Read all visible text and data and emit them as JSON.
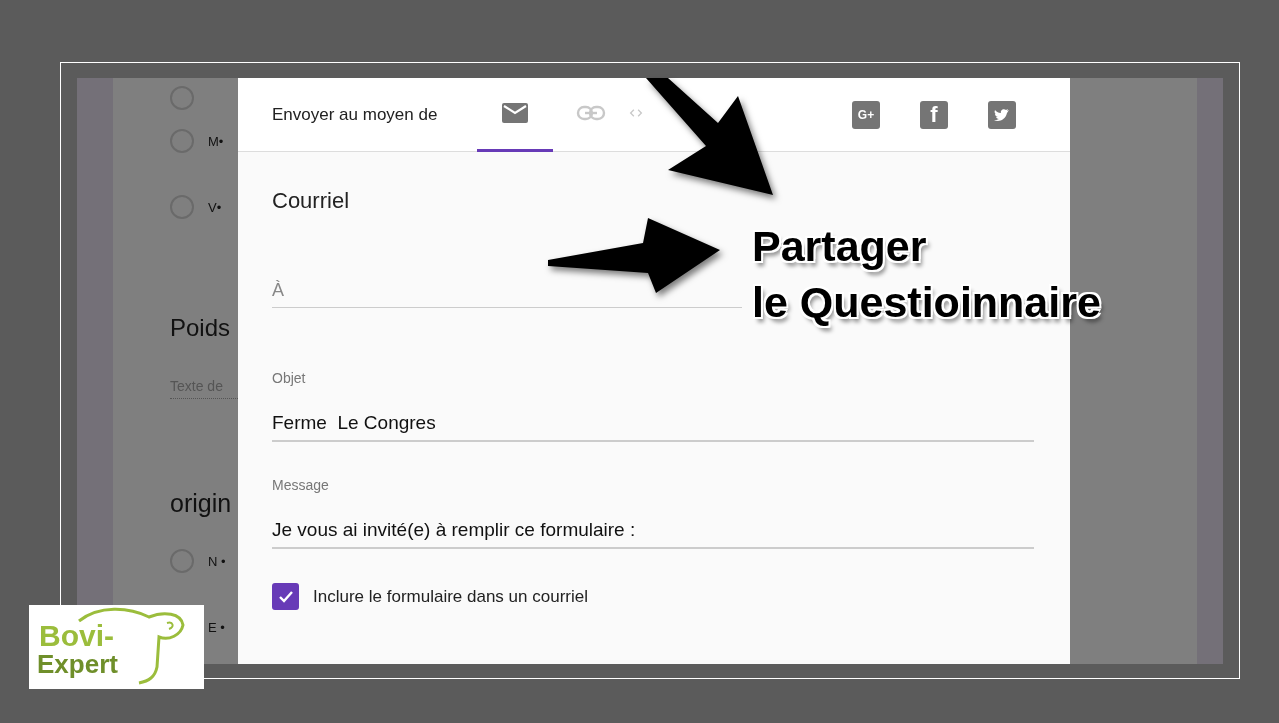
{
  "background_form": {
    "options_top": [
      {
        "kind": "cut",
        "selected": false
      },
      {
        "kind": "option",
        "label": "M•",
        "selected": false
      },
      {
        "kind": "option",
        "label": "V•",
        "selected": false
      }
    ],
    "question_1": "Poids",
    "answer_hint": "Texte de",
    "question_2": "origin",
    "options_bottom": [
      {
        "kind": "option",
        "label": "N •",
        "selected": false
      },
      {
        "kind": "label_only",
        "label": "E •"
      }
    ]
  },
  "dialog": {
    "send_via_label": "Envoyer au moyen de",
    "tabs": [
      {
        "kind": "mail",
        "selected": true
      },
      {
        "kind": "link",
        "selected": false
      },
      {
        "kind": "embed",
        "selected": false
      }
    ],
    "share_icons": [
      {
        "kind": "gplus",
        "label": "G+"
      },
      {
        "kind": "facebook",
        "label": "f"
      },
      {
        "kind": "twitter"
      }
    ],
    "section_title": "Courriel",
    "to_field": {
      "placeholder": "À"
    },
    "subject_field": {
      "label": "Objet",
      "value": "Ferme  Le Congres"
    },
    "message_field": {
      "label": "Message",
      "value": "Je vous ai invité(e) à remplir ce formulaire :"
    },
    "include_form": {
      "label": "Inclure le formulaire dans un courriel",
      "checked": true
    }
  },
  "annotation": {
    "lines": [
      "Partager",
      "le Questioinnaire"
    ]
  },
  "logo": {
    "line_1": "Bovi-",
    "line_2": "Expert"
  }
}
